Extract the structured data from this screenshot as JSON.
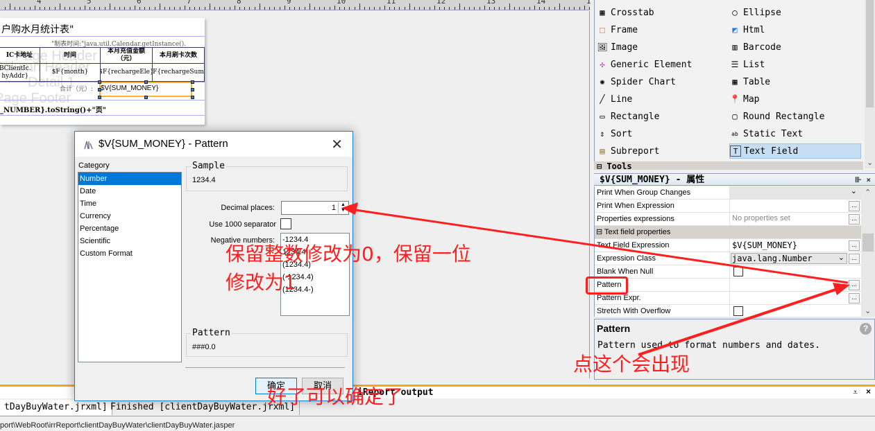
{
  "ruler": {
    "numbers": [
      "4",
      "5",
      "6",
      "7",
      "8",
      "9",
      "10",
      "11",
      "12",
      "13",
      "14",
      "1"
    ]
  },
  "report": {
    "title": "户购水月统计表\"",
    "ghost_labels": [
      "Page Header",
      "Column Header",
      "Detail 1",
      "Page Footer"
    ],
    "created_time": "\"制表时间:\"java.util.Calendar.getInstance().",
    "headers": [
      "IC卡地址",
      "时间",
      "本月充值金额（元）",
      "本月刷卡次数"
    ],
    "row": [
      "BClientIc.\nhyAddr}",
      "$F{month}",
      "$F{rechargeEle}",
      "$F{rechargeSum}"
    ],
    "total_label": "合计（元）:",
    "total_field": "$V{SUM_MONEY}",
    "page_footer": "_NUMBER}.toString()+\"页\""
  },
  "palette": {
    "left": [
      {
        "label": "Crosstab",
        "icon": "crosstab-icon"
      },
      {
        "label": "Frame",
        "icon": "frame-icon"
      },
      {
        "label": "Image",
        "icon": "image-icon"
      },
      {
        "label": "Generic Element",
        "icon": "generic-element-icon"
      },
      {
        "label": "Spider Chart",
        "icon": "spider-chart-icon"
      },
      {
        "label": "Line",
        "icon": "line-icon"
      },
      {
        "label": "Rectangle",
        "icon": "rectangle-icon"
      },
      {
        "label": "Sort",
        "icon": "sort-icon"
      },
      {
        "label": "Subreport",
        "icon": "subreport-icon"
      }
    ],
    "right": [
      {
        "label": "Ellipse",
        "icon": "ellipse-icon"
      },
      {
        "label": "Html",
        "icon": "html-icon"
      },
      {
        "label": "Barcode",
        "icon": "barcode-icon"
      },
      {
        "label": "List",
        "icon": "list-icon"
      },
      {
        "label": "Table",
        "icon": "table-icon"
      },
      {
        "label": "Map",
        "icon": "map-icon"
      },
      {
        "label": "Round Rectangle",
        "icon": "round-rectangle-icon"
      },
      {
        "label": "Static Text",
        "icon": "static-text-icon"
      },
      {
        "label": "Text Field",
        "icon": "text-field-icon",
        "selected": true
      }
    ],
    "tools_header": "Tools"
  },
  "properties": {
    "title": "$V{SUM_MONEY} - 属性",
    "rows": [
      {
        "key": "Print When Group Changes",
        "value": "",
        "type": "select"
      },
      {
        "key": "Print When Expression",
        "value": "",
        "type": "dots"
      },
      {
        "key": "Properties expressions",
        "value": "No properties set",
        "type": "dots"
      },
      {
        "key": "Text field properties",
        "type": "section"
      },
      {
        "key": "Text Field Expression",
        "value": "$V{SUM_MONEY}",
        "type": "dots"
      },
      {
        "key": "Expression Class",
        "value": "java.lang.Number",
        "type": "select-dots"
      },
      {
        "key": "Blank When Null",
        "value": "",
        "type": "checkbox"
      },
      {
        "key": "Pattern",
        "value": "",
        "type": "dots"
      },
      {
        "key": "Pattern Expr.",
        "value": "",
        "type": "dots"
      },
      {
        "key": "Stretch With Overflow",
        "value": "",
        "type": "checkbox"
      }
    ],
    "description_title": "Pattern",
    "description_text": "Pattern used to format numbers and dates."
  },
  "output": {
    "header": "iReport output",
    "tabs": [
      "tDayBuyWater.jrxml]",
      "Finished [clientDayBuyWater.jrxml]"
    ],
    "status": "port\\WebRoot\\irrReport\\clientDayBuyWater\\clientDayBuyWater.jasper"
  },
  "dialog": {
    "title": "$V{SUM_MONEY} - Pattern",
    "category_label": "Category",
    "categories": [
      "Number",
      "Date",
      "Time",
      "Currency",
      "Percentage",
      "Scientific",
      "Custom Format"
    ],
    "selected_category": "Number",
    "sample_label": "Sample",
    "sample_value": "1234.4",
    "decimal_places_label": "Decimal places:",
    "decimal_places_value": "1",
    "separator_label": "Use 1000 separator",
    "separator_checked": false,
    "negative_label": "Negative numbers:",
    "negative_options": [
      "-1234.4",
      "1234.4-",
      "(1234.4)",
      "(-1234.4)",
      "(1234.4-)"
    ],
    "pattern_label": "Pattern",
    "pattern_value": "###0.0",
    "ok_label": "确定",
    "cancel_label": "取消"
  },
  "annotations": {
    "note_decimal": [
      "保留整数修改为0，保留一位",
      "修改为1"
    ],
    "note_click": "点这个会出现",
    "note_confirm": "好了可以确定了",
    "color": "#ff1f1f"
  }
}
